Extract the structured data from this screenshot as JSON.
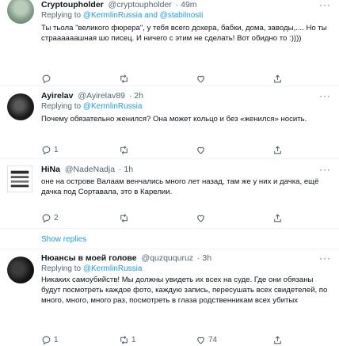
{
  "tweets": [
    {
      "name": "Cryptoupholder",
      "handle": "@cryptoupholder",
      "time": "· 49m",
      "replying_label": "Replying to",
      "mentions": "@KermlinRussia and @stabilnosti",
      "text": "Ты тьола \"великого фюрера\", у тебя всего дохера, бабки, дома, заводы,.... Но ты страааааашная шо писец. И ничего с этим не сделать! Вот обидно то :))))",
      "actions": {
        "reply": "",
        "retweet": "",
        "like": "",
        "share": ""
      }
    },
    {
      "name": "Ayirelav",
      "handle": "@Ayirelav89",
      "time": "· 2h",
      "replying_label": "Replying to",
      "mentions": "@KermlinRussia",
      "text": "Почему обязательно женился? Она может кольцо и без «женился» носить.",
      "actions": {
        "reply": "1",
        "retweet": "",
        "like": "",
        "share": ""
      }
    },
    {
      "name": "HiNa",
      "handle": "@NadeNadja",
      "time": "· 1h",
      "text": "оне на острове Валаам венчались много лет назад, там же у них и дачка, ещё дачка под Сортавала, это в Карелии.",
      "actions": {
        "reply": "2",
        "retweet": "",
        "like": "",
        "share": ""
      }
    },
    {
      "name": "Нюансы в моей голове",
      "handle": "@quzququruz",
      "time": "· 3h",
      "replying_label": "Replying to",
      "mentions": "@KermlinRussia",
      "text": "Никаких самоубийств! Мы должны увидеть их всех на суде. Где они обязаны будут посмотреть каждое фото, каждую запись, пересушать всех свидетелей, по много, много, много раз, посмотреть в глаза родственникам всех убитых",
      "actions": {
        "reply": "1",
        "retweet": "1",
        "like": "74",
        "share": ""
      }
    }
  ],
  "show_replies": "Show replies",
  "colors": {
    "accent": "#1d9bf0",
    "muted": "#536471",
    "text": "#0f1419",
    "divider": "#eff3f4"
  }
}
